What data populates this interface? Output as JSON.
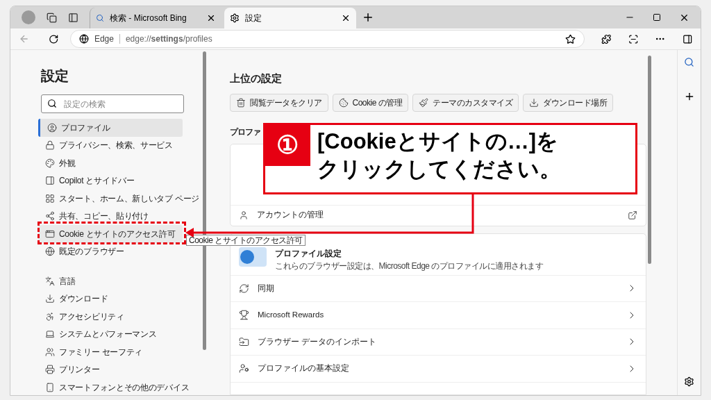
{
  "tabs": [
    {
      "title": "検索 - Microsoft Bing",
      "selected": false
    },
    {
      "title": "設定",
      "selected": true
    }
  ],
  "address": {
    "label": "Edge",
    "url": "edge://**settings**/profiles"
  },
  "sidebar": {
    "title": "設定",
    "search": {
      "placeholder": "設定の検索"
    },
    "sections": [
      [
        {
          "label": "プロファイル",
          "selected": true,
          "hovered": false
        },
        {
          "label": "プライバシー、検索、サービス",
          "selected": false,
          "hovered": false
        },
        {
          "label": "外観",
          "selected": false,
          "hovered": false
        },
        {
          "label": "Copilot とサイドバー",
          "selected": false,
          "hovered": false
        },
        {
          "label": "スタート、ホーム、新しいタブ ページ",
          "selected": false,
          "hovered": false
        },
        {
          "label": "共有、コピー、貼り付け",
          "selected": false,
          "hovered": false
        },
        {
          "label": "Cookie とサイトのアクセス許可",
          "selected": false,
          "hovered": true
        },
        {
          "label": "既定のブラウザー",
          "selected": false,
          "hovered": false
        }
      ],
      [
        {
          "label": "言語",
          "selected": false,
          "hovered": false
        },
        {
          "label": "ダウンロード",
          "selected": false,
          "hovered": false
        },
        {
          "label": "アクセシビリティ",
          "selected": false,
          "hovered": false
        },
        {
          "label": "システムとパフォーマンス",
          "selected": false,
          "hovered": false
        },
        {
          "label": "ファミリー セーフティ",
          "selected": false,
          "hovered": false
        },
        {
          "label": "プリンター",
          "selected": false,
          "hovered": false
        },
        {
          "label": "スマートフォンとその他のデバイス",
          "selected": false,
          "hovered": false
        }
      ]
    ]
  },
  "tooltip": "Cookie とサイトのアクセス許可",
  "main": {
    "title": "上位の設定",
    "quick_buttons": [
      "閲覧データをクリア",
      "Cookie の管理",
      "テーマのカスタマイズ",
      "ダウンロード場所"
    ],
    "profile_heading": "プロファ",
    "account_row": "アカウントの管理",
    "profile_settings": {
      "title": "プロファイル設定",
      "subtitle": "これらのブラウザー設定は、Microsoft Edge のプロファイルに適用されます",
      "rows": [
        "同期",
        "Microsoft Rewards",
        "ブラウザー データのインポート",
        "プロファイルの基本設定"
      ]
    }
  },
  "annotation": {
    "step": "①",
    "lines": [
      "[Cookieとサイトの…]を",
      "クリックしてください。"
    ]
  }
}
